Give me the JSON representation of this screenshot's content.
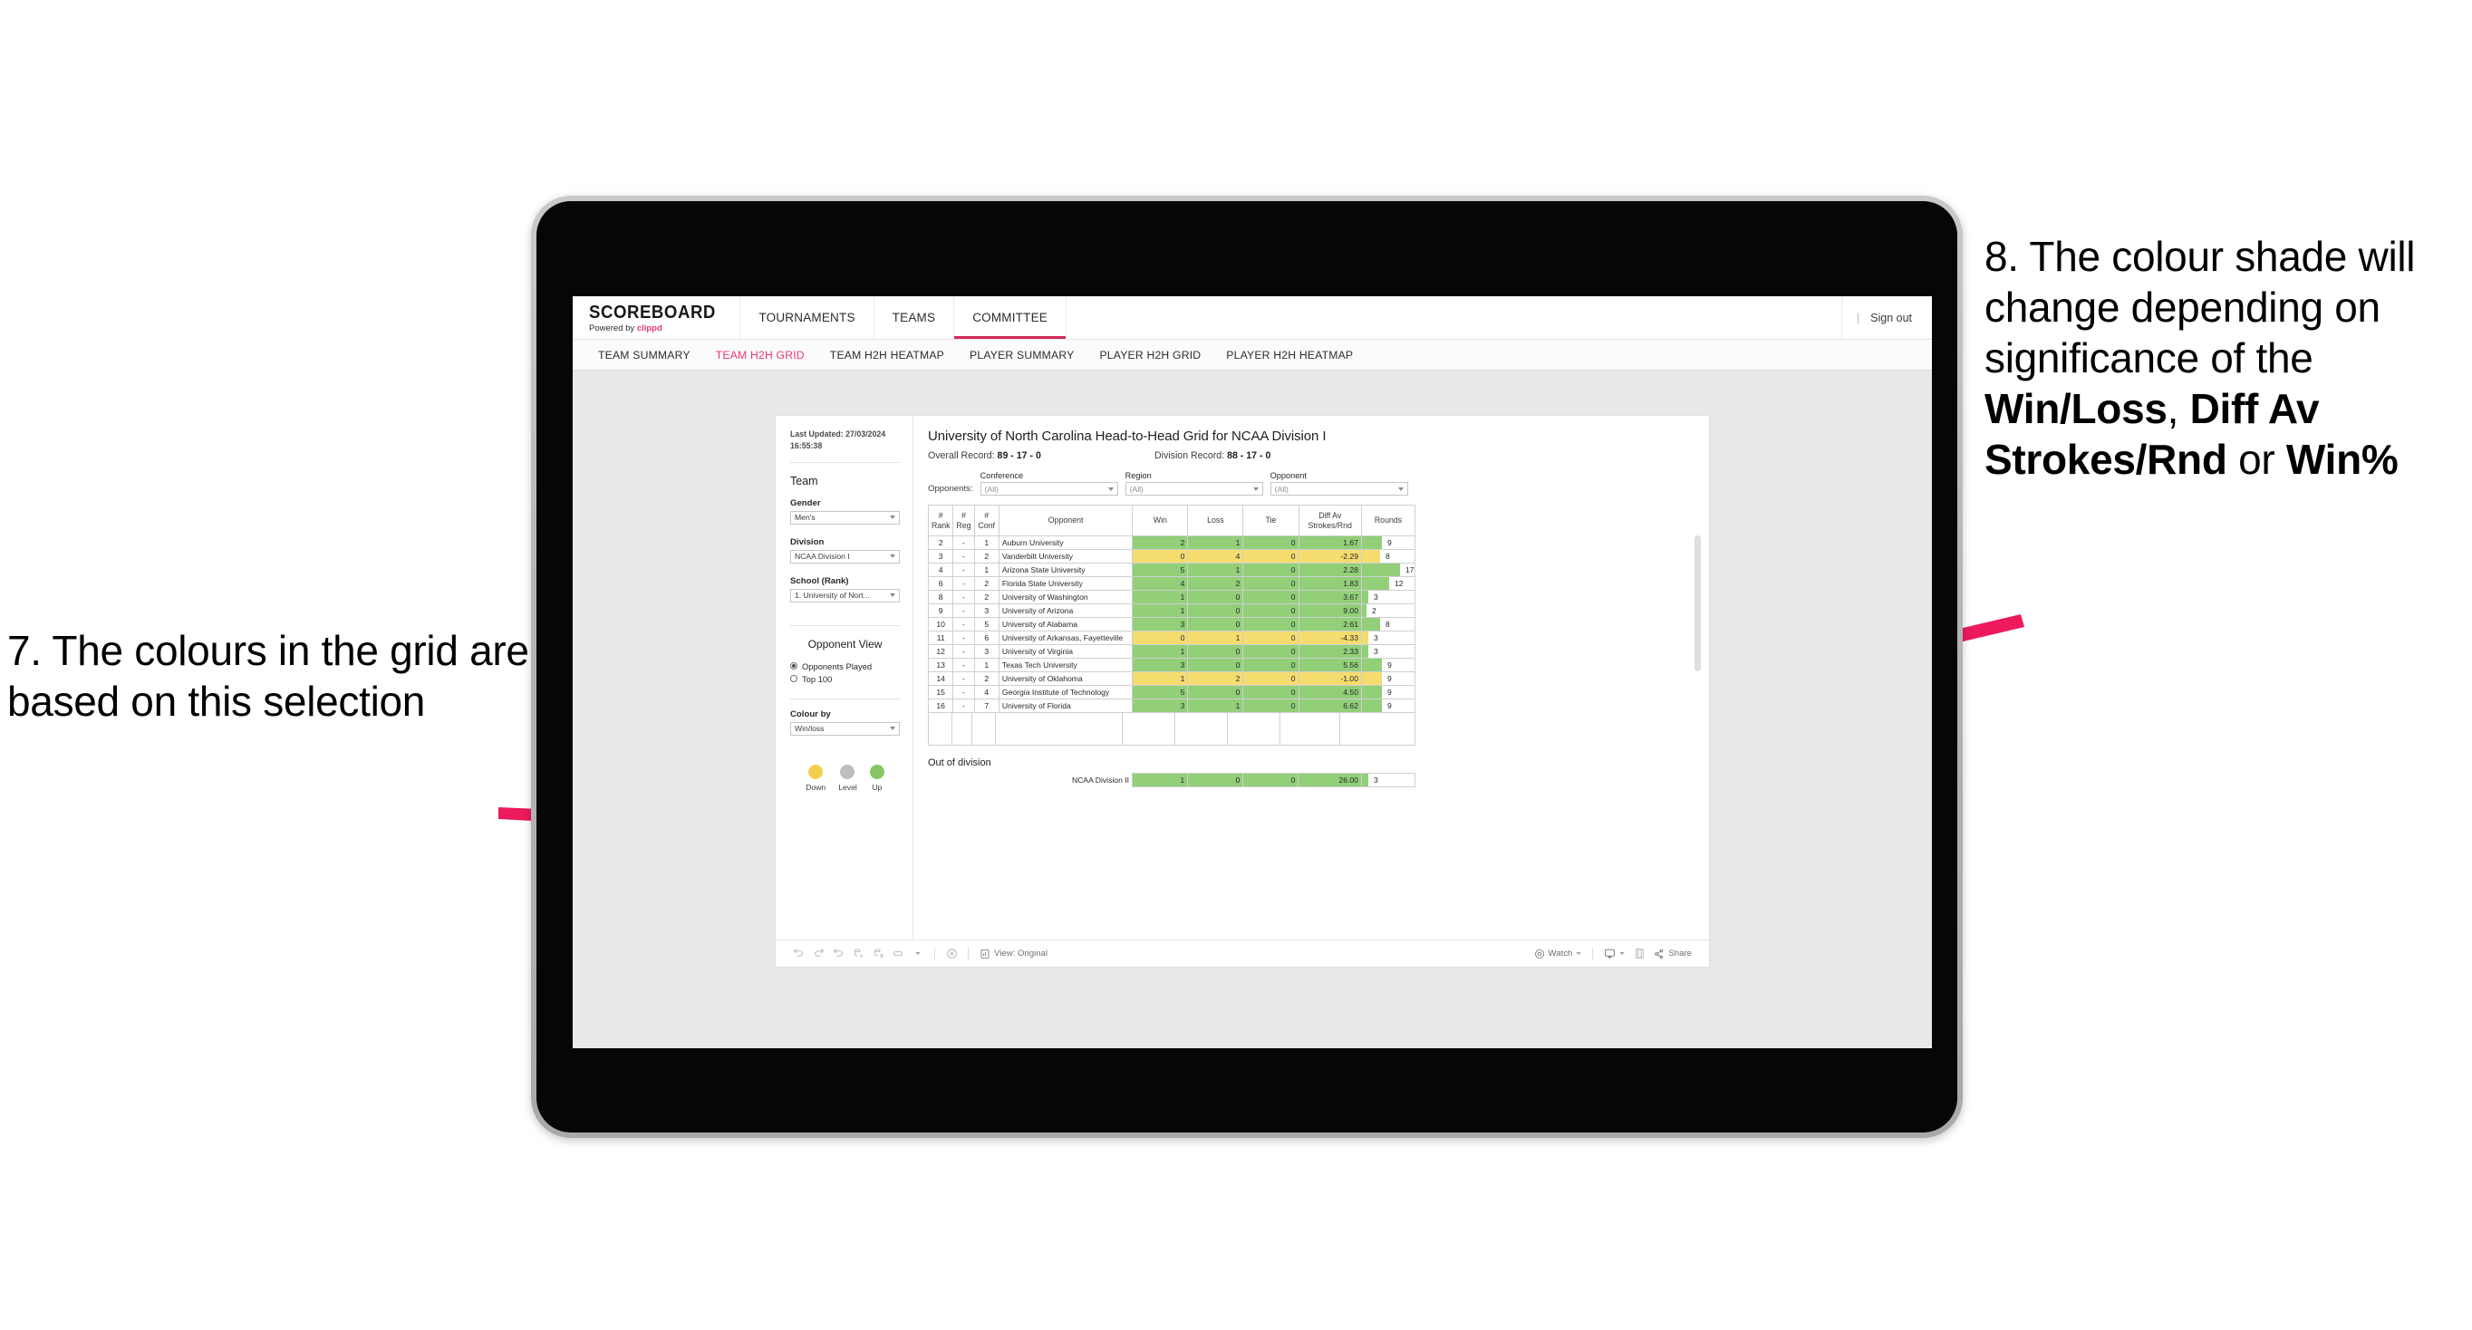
{
  "annotations": {
    "left": {
      "text": "7. The colours in the grid are based on this selection"
    },
    "right": {
      "line1": "8. The colour shade will change depending on significance of the ",
      "bold1": "Win/Loss",
      "mid1": ", ",
      "bold2": "Diff Av Strokes/Rnd",
      "mid2": " or ",
      "bold3": "Win%"
    },
    "arrow_color": "#ed1a5c"
  },
  "app": {
    "brand": {
      "name": "SCOREBOARD",
      "powered_prefix": "Powered by ",
      "powered_brand": "clippd"
    },
    "nav": [
      {
        "label": "TOURNAMENTS",
        "active": false
      },
      {
        "label": "TEAMS",
        "active": false
      },
      {
        "label": "COMMITTEE",
        "active": true
      }
    ],
    "signout": {
      "divider": "|",
      "label": "Sign out"
    },
    "subnav": [
      {
        "label": "TEAM SUMMARY",
        "active": false
      },
      {
        "label": "TEAM H2H GRID",
        "active": true
      },
      {
        "label": "TEAM H2H HEATMAP",
        "active": false
      },
      {
        "label": "PLAYER SUMMARY",
        "active": false
      },
      {
        "label": "PLAYER H2H GRID",
        "active": false
      },
      {
        "label": "PLAYER H2H HEATMAP",
        "active": false
      }
    ]
  },
  "sidebar": {
    "last_updated": "Last Updated: 27/03/2024 16:55:38",
    "team_heading": "Team",
    "gender": {
      "label": "Gender",
      "value": "Men's"
    },
    "division": {
      "label": "Division",
      "value": "NCAA Division I"
    },
    "school": {
      "label": "School (Rank)",
      "value": "1. University of Nort..."
    },
    "opponent_view": {
      "heading": "Opponent View",
      "options": [
        {
          "label": "Opponents Played",
          "selected": true
        },
        {
          "label": "Top 100",
          "selected": false
        }
      ]
    },
    "colour_by": {
      "label": "Colour by",
      "value": "Win/loss"
    },
    "legend": [
      {
        "label": "Down",
        "color": "#f2cf4f"
      },
      {
        "label": "Level",
        "color": "#bcbec2"
      },
      {
        "label": "Up",
        "color": "#87c765"
      }
    ]
  },
  "main": {
    "title": "University of North Carolina Head-to-Head Grid for NCAA Division I",
    "overall_record_label": "Overall Record: ",
    "overall_record_value": "89 - 17 - 0",
    "division_record_label": "Division Record: ",
    "division_record_value": "88 - 17 - 0",
    "filters": {
      "lead": "Opponents:",
      "items": [
        {
          "label": "Conference",
          "value": "(All)"
        },
        {
          "label": "Region",
          "value": "(All)"
        },
        {
          "label": "Opponent",
          "value": "(All)"
        }
      ]
    },
    "out_of_division_title": "Out of division"
  },
  "chart_data": {
    "type": "table",
    "title": "University of North Carolina Head-to-Head Grid for NCAA Division I",
    "columns": [
      "# Rank",
      "# Reg",
      "# Conf",
      "Opponent",
      "Win",
      "Loss",
      "Tie",
      "Diff Av Strokes/Rnd",
      "Rounds"
    ],
    "column_headers_multiline": [
      [
        "#",
        "Rank"
      ],
      [
        "#",
        "Reg"
      ],
      [
        "#",
        "Conf"
      ],
      [
        "Opponent"
      ],
      [
        "Win"
      ],
      [
        "Loss"
      ],
      [
        "Tie"
      ],
      [
        "Diff Av",
        "Strokes/Rnd"
      ],
      [
        "Rounds"
      ]
    ],
    "rounds_max": 17,
    "colors": {
      "up": "#92cf78",
      "down": "#f5dc6e",
      "level": "#bcbec2"
    },
    "rows": [
      {
        "rank": "2",
        "reg": "-",
        "conf": "1",
        "opponent": "Auburn University",
        "win": "2",
        "loss": "1",
        "tie": "0",
        "diff": "1.67",
        "rounds": "9",
        "rounds_n": 9,
        "tone": "green"
      },
      {
        "rank": "3",
        "reg": "-",
        "conf": "2",
        "opponent": "Vanderbilt University",
        "win": "0",
        "loss": "4",
        "tie": "0",
        "diff": "-2.29",
        "rounds": "8",
        "rounds_n": 8,
        "tone": "yellow"
      },
      {
        "rank": "4",
        "reg": "-",
        "conf": "1",
        "opponent": "Arizona State University",
        "win": "5",
        "loss": "1",
        "tie": "0",
        "diff": "2.28",
        "rounds": "17",
        "rounds_n": 17,
        "tone": "green"
      },
      {
        "rank": "6",
        "reg": "-",
        "conf": "2",
        "opponent": "Florida State University",
        "win": "4",
        "loss": "2",
        "tie": "0",
        "diff": "1.83",
        "rounds": "12",
        "rounds_n": 12,
        "tone": "green"
      },
      {
        "rank": "8",
        "reg": "-",
        "conf": "2",
        "opponent": "University of Washington",
        "win": "1",
        "loss": "0",
        "tie": "0",
        "diff": "3.67",
        "rounds": "3",
        "rounds_n": 3,
        "tone": "green"
      },
      {
        "rank": "9",
        "reg": "-",
        "conf": "3",
        "opponent": "University of Arizona",
        "win": "1",
        "loss": "0",
        "tie": "0",
        "diff": "9.00",
        "rounds": "2",
        "rounds_n": 2,
        "tone": "green"
      },
      {
        "rank": "10",
        "reg": "-",
        "conf": "5",
        "opponent": "University of Alabama",
        "win": "3",
        "loss": "0",
        "tie": "0",
        "diff": "2.61",
        "rounds": "8",
        "rounds_n": 8,
        "tone": "green"
      },
      {
        "rank": "11",
        "reg": "-",
        "conf": "6",
        "opponent": "University of Arkansas, Fayetteville",
        "win": "0",
        "loss": "1",
        "tie": "0",
        "diff": "-4.33",
        "rounds": "3",
        "rounds_n": 3,
        "tone": "yellow"
      },
      {
        "rank": "12",
        "reg": "-",
        "conf": "3",
        "opponent": "University of Virginia",
        "win": "1",
        "loss": "0",
        "tie": "0",
        "diff": "2.33",
        "rounds": "3",
        "rounds_n": 3,
        "tone": "green"
      },
      {
        "rank": "13",
        "reg": "-",
        "conf": "1",
        "opponent": "Texas Tech University",
        "win": "3",
        "loss": "0",
        "tie": "0",
        "diff": "5.56",
        "rounds": "9",
        "rounds_n": 9,
        "tone": "green"
      },
      {
        "rank": "14",
        "reg": "-",
        "conf": "2",
        "opponent": "University of Oklahoma",
        "win": "1",
        "loss": "2",
        "tie": "0",
        "diff": "-1.00",
        "rounds": "9",
        "rounds_n": 9,
        "tone": "yellow"
      },
      {
        "rank": "15",
        "reg": "-",
        "conf": "4",
        "opponent": "Georgia Institute of Technology",
        "win": "5",
        "loss": "0",
        "tie": "0",
        "diff": "4.50",
        "rounds": "9",
        "rounds_n": 9,
        "tone": "green"
      },
      {
        "rank": "16",
        "reg": "-",
        "conf": "7",
        "opponent": "University of Florida",
        "win": "3",
        "loss": "1",
        "tie": "0",
        "diff": "6.62",
        "rounds": "9",
        "rounds_n": 9,
        "tone": "green"
      }
    ],
    "out_of_division": [
      {
        "opponent": "NCAA Division II",
        "win": "1",
        "loss": "0",
        "tie": "0",
        "diff": "26.00",
        "rounds": "3",
        "rounds_n": 3,
        "tone": "green"
      }
    ]
  },
  "toolbar": {
    "view_label": "View: Original",
    "watch_label": "Watch",
    "share_label": "Share"
  }
}
